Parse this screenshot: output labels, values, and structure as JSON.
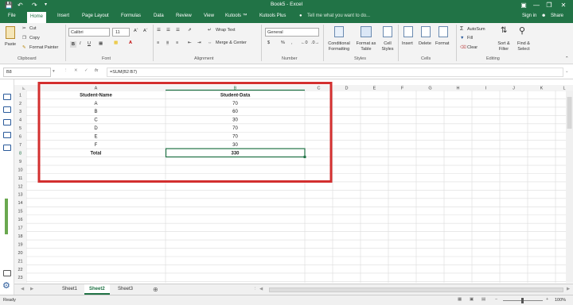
{
  "window": {
    "title": "Book5 - Excel",
    "user": "Sign in",
    "share": "Share"
  },
  "tabs": [
    "File",
    "Home",
    "Insert",
    "Page Layout",
    "Formulas",
    "Data",
    "Review",
    "View",
    "Kutools ™",
    "Kutools Plus"
  ],
  "tell_me": "Tell me what you want to do...",
  "ribbon": {
    "clipboard": {
      "paste": "Paste",
      "cut": "Cut",
      "copy": "Copy",
      "format_painter": "Format Painter",
      "label": "Clipboard"
    },
    "font": {
      "name": "Calibri",
      "size": "11",
      "bold": "B",
      "italic": "I",
      "underline": "U",
      "label": "Font"
    },
    "alignment": {
      "wrap": "Wrap Text",
      "merge": "Merge & Center",
      "label": "Alignment"
    },
    "number": {
      "format": "General",
      "currency": "$",
      "percent": "%",
      "comma": ",",
      "label": "Number"
    },
    "styles": {
      "cond": "Conditional Formatting",
      "table": "Format as Table",
      "cell": "Cell Styles",
      "label": "Styles"
    },
    "cells": {
      "insert": "Insert",
      "delete": "Delete",
      "format": "Format",
      "label": "Cells"
    },
    "editing": {
      "autosum": "AutoSum",
      "fill": "Fill",
      "clear": "Clear",
      "sort": "Sort & Filter",
      "find": "Find & Select",
      "label": "Editing"
    }
  },
  "formula_bar": {
    "name_box": "B8",
    "fx": "fx",
    "formula": "=SUM(B2:B7)"
  },
  "columns": [
    "A",
    "B",
    "C",
    "D",
    "E",
    "F",
    "G",
    "H",
    "I",
    "J",
    "K",
    "L"
  ],
  "rows": [
    "1",
    "2",
    "3",
    "4",
    "5",
    "6",
    "7",
    "8",
    "9",
    "10",
    "11",
    "12",
    "13",
    "14",
    "15",
    "16",
    "17",
    "18",
    "19",
    "20",
    "21",
    "22",
    "23"
  ],
  "table": {
    "headers": [
      "Student-Name",
      "Student-Data"
    ],
    "rows": [
      [
        "A",
        "70"
      ],
      [
        "B",
        "60"
      ],
      [
        "C",
        "30"
      ],
      [
        "D",
        "70"
      ],
      [
        "E",
        "70"
      ],
      [
        "F",
        "30"
      ]
    ],
    "total_label": "Total",
    "total_value": "330"
  },
  "sheets": [
    "Sheet1",
    "Sheet2",
    "Sheet3"
  ],
  "active_sheet": "Sheet2",
  "status": {
    "ready": "Ready",
    "zoom": "100%"
  },
  "colors": {
    "accent": "#217346",
    "highlight": "#d32f2f"
  }
}
